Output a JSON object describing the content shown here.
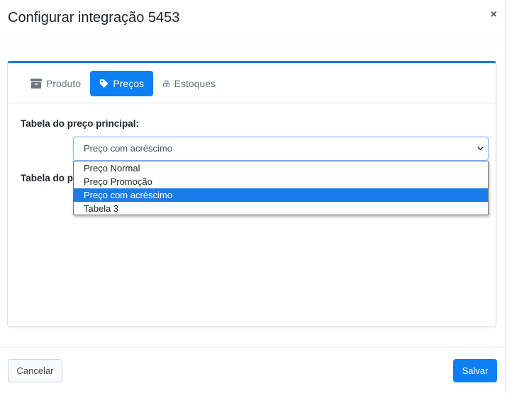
{
  "modal": {
    "title": "Configurar integração 5453",
    "close_label": "×"
  },
  "tabs": [
    {
      "label": "Produto",
      "icon": "box-icon",
      "active": false
    },
    {
      "label": "Preços",
      "icon": "tag-icon",
      "active": true
    },
    {
      "label": "Estoques",
      "icon": "cubes-icon",
      "active": false
    }
  ],
  "form": {
    "main_price_label": "Tabela do preço principal:",
    "second_label": "Tabela do p",
    "select_value": "Preço com acréscimo",
    "options": [
      "Preço Normal",
      "Preço Promoção",
      "Preço com acréscimo",
      "Tabela 3"
    ],
    "selected_index": 2
  },
  "footer": {
    "cancel_label": "Cancelar",
    "save_label": "Salvar"
  },
  "colors": {
    "accent": "#0d7ff2",
    "card_top_border": "#1a7bd6",
    "selected_option": "#1a7bea"
  }
}
